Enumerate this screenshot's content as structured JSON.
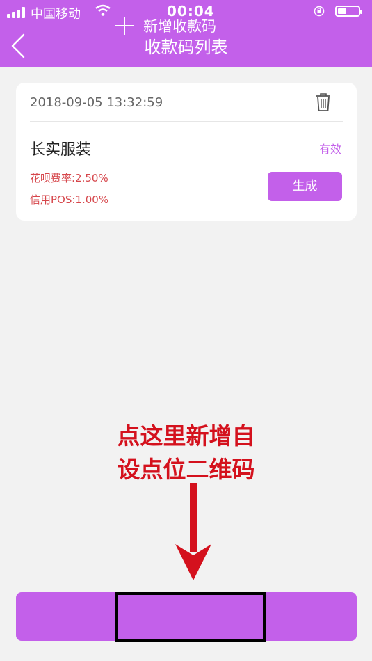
{
  "status_bar": {
    "carrier": "中国移动",
    "time": "00:04",
    "signal_icon": "signal-bars-icon",
    "wifi_icon": "wifi-icon",
    "lock_icon": "rotation-lock-icon",
    "battery_icon": "battery-icon"
  },
  "header": {
    "title": "收款码列表",
    "back_icon": "chevron-left-icon"
  },
  "card": {
    "datetime": "2018-09-05 13:32:59",
    "delete_icon": "trash-icon",
    "shop_name": "长实服装",
    "status": "有效",
    "huabei_rate": "花呗费率:2.50%",
    "credit_pos_rate": "信用POS:1.00%",
    "generate_label": "生成"
  },
  "annotation": {
    "line1": "点这里新增自",
    "line2": "设点位二维码"
  },
  "footer": {
    "add_label": "新增收款码",
    "add_icon": "plus-icon"
  },
  "colors": {
    "accent": "#c360ea",
    "annotation_red": "#d4111d",
    "rate_red": "#d6464b",
    "background": "#f2f2f2"
  }
}
